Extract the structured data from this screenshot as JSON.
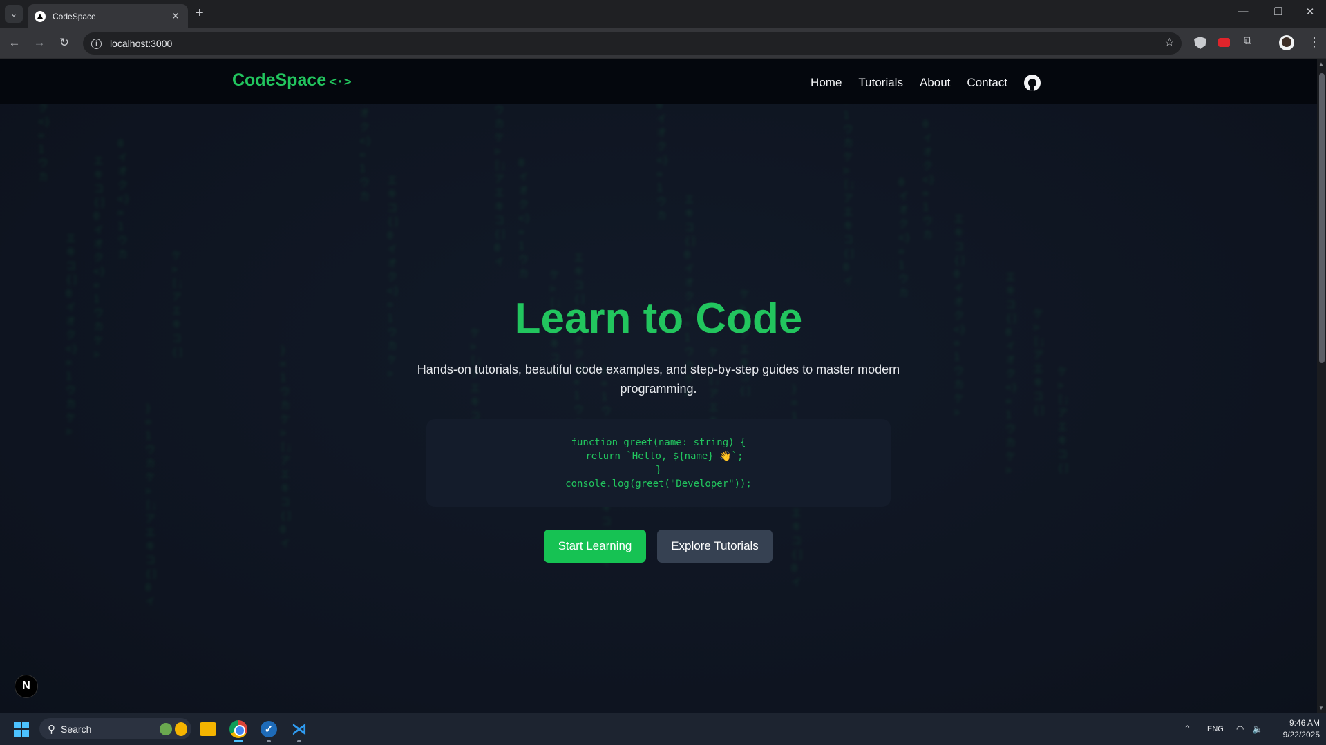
{
  "browser": {
    "tab_title": "CodeSpace",
    "tab_close": "✕",
    "new_tab": "+",
    "url": "localhost:3000",
    "window_controls": {
      "minimize": "—",
      "restore": "❐",
      "close": "✕"
    }
  },
  "site": {
    "logo_text": "CodeSpace",
    "logo_icon": "<·>",
    "nav": [
      "Home",
      "Tutorials",
      "About",
      "Contact"
    ],
    "hero_title": "Learn to Code",
    "hero_subtitle": "Hands-on tutorials, beautiful code examples, and step-by-step guides to master modern programming.",
    "code_lines": [
      "function greet(name: string) {",
      "  return `Hello, ${name} 👋`;",
      "}",
      "console.log(greet(\"Developer\"));"
    ],
    "primary_button": "Start Learning",
    "secondary_button": "Explore Tutorials",
    "dev_badge": "N"
  },
  "taskbar": {
    "search_label": "Search",
    "tray_language": "ENG",
    "time": "9:46 AM",
    "date": "9/22/2025"
  },
  "colors": {
    "accent": "#22c55e",
    "button_primary": "#16c253",
    "button_secondary": "#364152",
    "background": "#0f1521",
    "header": "#04070d"
  },
  "icons": [
    "tab-list-icon",
    "back-icon",
    "forward-icon",
    "reload-icon",
    "site-info-icon",
    "bookmark-star-icon",
    "shield-extension-icon",
    "youtube-extension-icon",
    "extensions-puzzle-icon",
    "profile-avatar-icon",
    "browser-menu-icon",
    "github-icon",
    "windows-start-icon",
    "search-icon",
    "file-explorer-icon",
    "chrome-icon",
    "vpn-icon",
    "vscode-icon",
    "wifi-icon",
    "volume-icon"
  ]
}
